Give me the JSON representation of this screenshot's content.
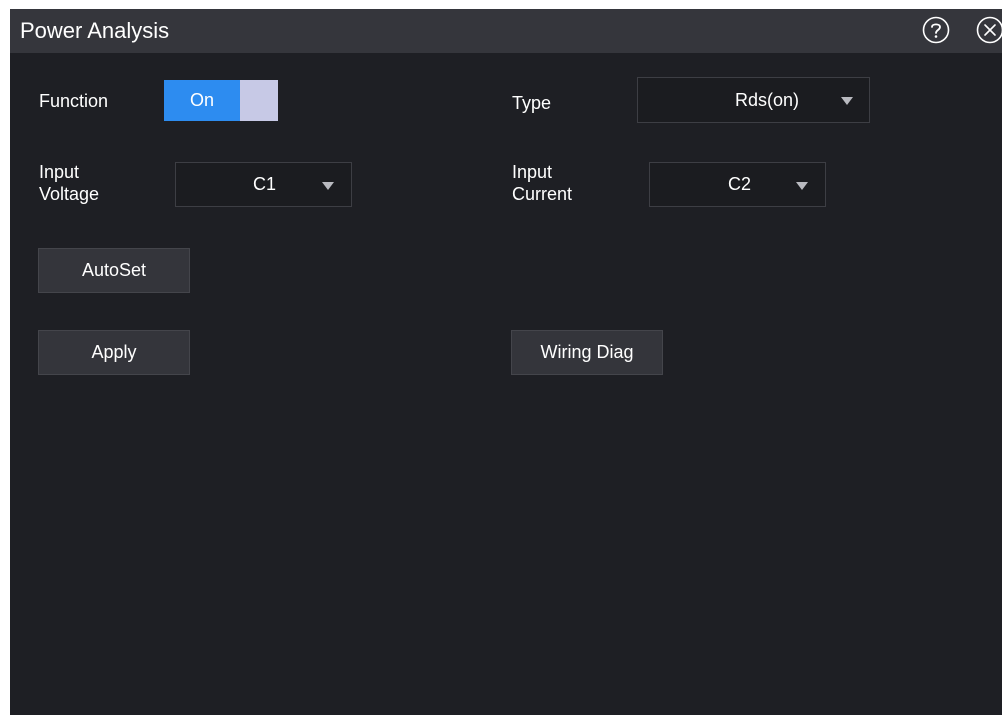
{
  "dialog": {
    "title": "Power Analysis"
  },
  "titlebar_icons": [
    "question-mark-icon",
    "close-x-icon"
  ],
  "function": {
    "label": "Function",
    "toggle_label": "On",
    "toggle_state": "on",
    "accent_color": "#2d8cf0"
  },
  "type": {
    "label": "Type",
    "value": "Rds(on)"
  },
  "input_voltage": {
    "label_line1": "Input",
    "label_line2": "Voltage",
    "value": "C1"
  },
  "input_current": {
    "label_line1": "Input",
    "label_line2": "Current",
    "value": "C2"
  },
  "buttons": {
    "autoset": "AutoSet",
    "apply": "Apply",
    "wiring_diag": "Wiring Diag"
  }
}
